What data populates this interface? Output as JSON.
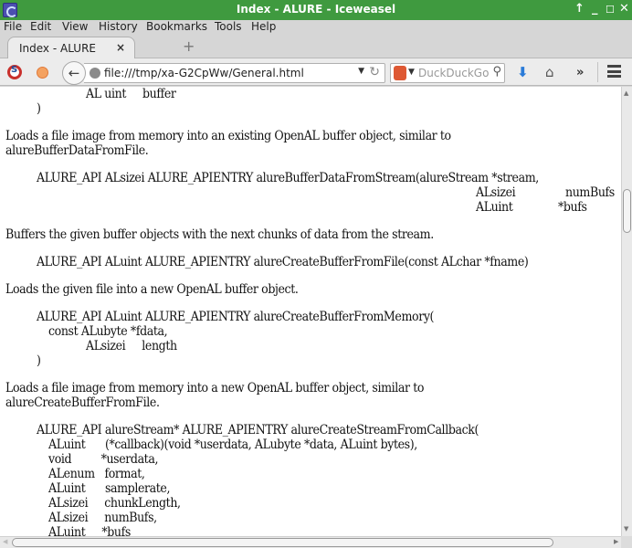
{
  "window": {
    "title": "Index - ALURE - Iceweasel",
    "controls": [
      "↑",
      "_",
      "☐",
      "✕"
    ]
  },
  "menubar": {
    "items": [
      {
        "label": "File",
        "accel": "F"
      },
      {
        "label": "Edit",
        "accel": "E"
      },
      {
        "label": "View",
        "accel": "V"
      },
      {
        "label": "History",
        "accel": "s"
      },
      {
        "label": "Bookmarks",
        "accel": "B"
      },
      {
        "label": "Tools",
        "accel": "T"
      },
      {
        "label": "Help",
        "accel": "H"
      }
    ]
  },
  "tabs": [
    {
      "label": "Index - ALURE",
      "close": "×",
      "active": true
    }
  ],
  "newtab_label": "+",
  "navbar": {
    "back_glyph": "←",
    "url": "file:///tmp/xa-G2CpWw/General.html",
    "url_dropdown": "▼",
    "reload_glyph": "↻",
    "search_engine_dropdown": "▼",
    "search_placeholder": "DuckDuckGo Search",
    "search_glyph": "⚲",
    "download_glyph": "⬇",
    "home_glyph": "⌂",
    "overflow_glyph": "»"
  },
  "document": {
    "lines": [
      "AL uint     buffer",
      ")",
      "Loads a file image from memory into an existing OpenAL buffer object, similar to",
      "alureBufferDataFromFile.",
      "ALURE_API ALsizei ALURE_APIENTRY alureBufferDataFromStream(alureStream *stream,",
      "ALsizei",
      "numBufs",
      "ALuint",
      "*bufs",
      "Buffers the given buffer objects with the next chunks of data from the stream.",
      "ALURE_API ALuint ALURE_APIENTRY alureCreateBufferFromFile(const ALchar *fname)",
      "Loads the given file into a new OpenAL buffer object.",
      "ALURE_API ALuint ALURE_APIENTRY alureCreateBufferFromMemory(",
      "const ALubyte *fdata,",
      "ALsizei     length",
      ")",
      "Loads a file image from memory into a new OpenAL buffer object, similar to",
      "alureCreateBufferFromFile.",
      "ALURE_API alureStream* ALURE_APIENTRY alureCreateStreamFromCallback(",
      "ALuint      (*callback)(void *userdata, ALubyte *data, ALuint bytes),",
      "void         *userdata,",
      "ALenum   format,",
      "ALuint      samplerate,",
      "ALsizei     chunkLength,",
      "ALsizei     numBufs,",
      "ALuint     *bufs"
    ]
  },
  "scrollbars": {
    "vertical_position": 0.25,
    "horizontal_position": 0.0
  }
}
